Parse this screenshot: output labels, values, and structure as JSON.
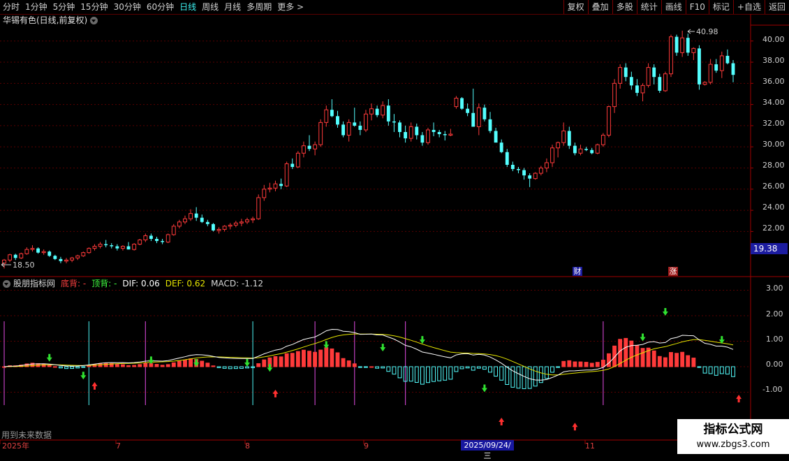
{
  "toolbar": {
    "periods": [
      "分时",
      "1分钟",
      "5分钟",
      "15分钟",
      "30分钟",
      "60分钟",
      "日线",
      "周线",
      "月线",
      "多周期",
      "更多 >"
    ],
    "active_period": "日线",
    "right_buttons": [
      "复权",
      "叠加",
      "多股",
      "统计",
      "画线",
      "F10",
      "标记",
      "+自选",
      "返回"
    ]
  },
  "main_chart": {
    "title": "华锡有色(日线,前复权)",
    "y_axis_labels": [
      "40.00",
      "38.00",
      "36.00",
      "34.00",
      "32.00",
      "30.00",
      "28.00",
      "26.00",
      "24.00",
      "22.00"
    ],
    "high_marker": "40.98",
    "low_marker": "18.50",
    "current_price": "19.38",
    "event_badges": [
      "财",
      "涨"
    ]
  },
  "indicator": {
    "name": "股朋指标网",
    "bottom_div_label": "底背: -",
    "top_div_label": "顶背: -",
    "dif_label": "DIF: 0.06",
    "dea_label": "DEF: 0.62",
    "macd_label": "MACD: -1.12",
    "y_axis_labels": [
      "3.00",
      "2.00",
      "1.00",
      "0.00",
      "-1.00"
    ]
  },
  "x_axis": {
    "labels": [
      "2025年",
      "7",
      "8",
      "9",
      "11"
    ],
    "cursor_date": "2025/09/24/三"
  },
  "footer_note": "用到未来数据",
  "watermark": {
    "line1": "指标公式网",
    "line2": "www.zbgs3.com"
  },
  "colors": {
    "up": "#ff3a3a",
    "down": "#54ffff",
    "dif": "#ffffff",
    "dea": "#e6e600",
    "grid": "#5a0000",
    "accent_blue": "#1c1ca0"
  },
  "chart_data": {
    "type": "candlestick",
    "ohlc": [
      [
        19.0,
        19.4,
        18.5,
        19.3
      ],
      [
        19.3,
        19.9,
        19.1,
        19.8
      ],
      [
        19.8,
        19.9,
        19.3,
        19.5
      ],
      [
        19.5,
        20.0,
        19.4,
        19.9
      ],
      [
        19.9,
        20.5,
        19.8,
        20.3
      ],
      [
        20.3,
        20.7,
        20.1,
        20.4
      ],
      [
        20.4,
        20.5,
        19.9,
        20.0
      ],
      [
        20.0,
        20.3,
        19.8,
        20.1
      ],
      [
        20.1,
        20.2,
        19.6,
        19.7
      ],
      [
        19.7,
        19.8,
        19.3,
        19.4
      ],
      [
        19.4,
        19.6,
        19.0,
        19.2
      ],
      [
        19.2,
        19.5,
        19.0,
        19.3
      ],
      [
        19.3,
        19.6,
        19.1,
        19.5
      ],
      [
        19.5,
        19.8,
        19.3,
        19.7
      ],
      [
        19.7,
        20.1,
        19.6,
        20.0
      ],
      [
        20.0,
        20.5,
        19.9,
        20.4
      ],
      [
        20.4,
        20.8,
        20.2,
        20.6
      ],
      [
        20.6,
        21.0,
        20.4,
        20.8
      ],
      [
        20.8,
        21.2,
        20.5,
        20.7
      ],
      [
        20.7,
        20.9,
        20.4,
        20.6
      ],
      [
        20.6,
        20.8,
        20.2,
        20.4
      ],
      [
        20.4,
        20.7,
        20.2,
        20.6
      ],
      [
        20.6,
        21.0,
        20.3,
        20.3
      ],
      [
        20.3,
        20.9,
        20.2,
        20.8
      ],
      [
        20.8,
        21.3,
        20.7,
        21.2
      ],
      [
        21.2,
        21.8,
        21.0,
        21.6
      ],
      [
        21.6,
        21.8,
        21.1,
        21.3
      ],
      [
        21.3,
        21.5,
        20.9,
        21.1
      ],
      [
        21.1,
        21.3,
        20.8,
        21.0
      ],
      [
        21.0,
        21.8,
        20.9,
        21.7
      ],
      [
        21.7,
        22.7,
        21.6,
        22.5
      ],
      [
        22.5,
        23.1,
        22.3,
        22.9
      ],
      [
        22.9,
        23.5,
        22.7,
        23.2
      ],
      [
        23.2,
        24.1,
        23.0,
        23.7
      ],
      [
        23.7,
        24.3,
        23.0,
        23.3
      ],
      [
        23.3,
        23.6,
        22.8,
        22.9
      ],
      [
        22.9,
        23.1,
        22.5,
        22.7
      ],
      [
        22.7,
        22.8,
        22.0,
        22.1
      ],
      [
        22.1,
        22.4,
        21.8,
        22.2
      ],
      [
        22.2,
        22.6,
        22.0,
        22.5
      ],
      [
        22.5,
        22.8,
        22.2,
        22.6
      ],
      [
        22.6,
        23.0,
        22.4,
        22.8
      ],
      [
        22.8,
        23.2,
        22.5,
        22.9
      ],
      [
        22.9,
        23.3,
        22.7,
        23.1
      ],
      [
        23.1,
        23.4,
        22.8,
        23.2
      ],
      [
        23.2,
        25.5,
        23.1,
        25.2
      ],
      [
        25.2,
        26.4,
        24.9,
        26.0
      ],
      [
        26.0,
        26.6,
        25.7,
        26.1
      ],
      [
        26.1,
        26.8,
        25.8,
        26.5
      ],
      [
        26.5,
        27.0,
        26.0,
        26.3
      ],
      [
        26.3,
        28.6,
        26.2,
        28.4
      ],
      [
        28.4,
        28.9,
        27.9,
        28.1
      ],
      [
        28.1,
        29.6,
        28.0,
        29.4
      ],
      [
        29.4,
        30.5,
        29.0,
        30.1
      ],
      [
        30.1,
        31.1,
        29.6,
        29.8
      ],
      [
        29.8,
        30.5,
        29.2,
        30.2
      ],
      [
        30.2,
        32.6,
        30.0,
        32.3
      ],
      [
        32.3,
        33.9,
        31.9,
        33.5
      ],
      [
        33.5,
        34.5,
        32.8,
        32.9
      ],
      [
        32.9,
        33.4,
        31.8,
        32.1
      ],
      [
        32.1,
        32.4,
        30.9,
        31.1
      ],
      [
        31.1,
        32.6,
        30.5,
        32.3
      ],
      [
        32.3,
        33.7,
        31.9,
        32.0
      ],
      [
        32.0,
        32.4,
        31.1,
        31.6
      ],
      [
        31.6,
        33.5,
        31.4,
        33.1
      ],
      [
        33.1,
        34.1,
        32.5,
        33.6
      ],
      [
        33.6,
        33.9,
        32.8,
        33.0
      ],
      [
        33.0,
        34.3,
        32.7,
        33.9
      ],
      [
        33.9,
        34.5,
        32.0,
        32.4
      ],
      [
        32.4,
        33.1,
        31.4,
        32.3
      ],
      [
        32.3,
        32.5,
        30.9,
        31.4
      ],
      [
        31.4,
        32.0,
        30.4,
        30.8
      ],
      [
        30.8,
        32.3,
        30.5,
        31.9
      ],
      [
        31.9,
        32.2,
        30.7,
        31.1
      ],
      [
        31.1,
        31.4,
        30.1,
        30.4
      ],
      [
        30.4,
        31.8,
        30.2,
        31.6
      ],
      [
        31.6,
        32.3,
        31.0,
        31.4
      ],
      [
        31.4,
        31.6,
        30.9,
        31.2
      ],
      [
        31.2,
        31.5,
        30.6,
        31.1
      ],
      [
        31.1,
        31.7,
        31.0,
        31.2
      ],
      [
        33.8,
        34.8,
        33.6,
        34.6
      ],
      [
        34.6,
        34.7,
        33.5,
        33.6
      ],
      [
        33.6,
        34.1,
        32.9,
        33.2
      ],
      [
        33.2,
        35.5,
        32.0,
        31.9
      ],
      [
        31.9,
        34.1,
        31.1,
        33.7
      ],
      [
        33.7,
        34.0,
        32.4,
        32.6
      ],
      [
        32.6,
        33.3,
        31.3,
        31.5
      ],
      [
        31.5,
        31.8,
        30.5,
        30.4
      ],
      [
        30.4,
        30.7,
        29.4,
        29.5
      ],
      [
        29.5,
        29.8,
        28.1,
        28.3
      ],
      [
        28.3,
        28.6,
        27.7,
        27.9
      ],
      [
        27.9,
        28.1,
        27.5,
        27.8
      ],
      [
        27.8,
        28.0,
        26.9,
        27.3
      ],
      [
        27.3,
        27.5,
        26.2,
        27.0
      ],
      [
        27.0,
        27.6,
        26.9,
        27.5
      ],
      [
        27.5,
        28.2,
        27.3,
        28.0
      ],
      [
        28.0,
        28.9,
        27.6,
        28.5
      ],
      [
        28.5,
        30.2,
        28.1,
        29.9
      ],
      [
        29.9,
        30.5,
        29.0,
        30.4
      ],
      [
        30.4,
        32.3,
        30.1,
        31.5
      ],
      [
        31.5,
        31.9,
        29.8,
        30.1
      ],
      [
        30.1,
        30.4,
        29.2,
        29.4
      ],
      [
        29.4,
        30.2,
        29.2,
        29.8
      ],
      [
        29.8,
        30.0,
        29.6,
        29.7
      ],
      [
        29.7,
        29.9,
        29.3,
        29.4
      ],
      [
        29.4,
        30.3,
        29.3,
        30.2
      ],
      [
        30.2,
        31.3,
        30.0,
        31.1
      ],
      [
        31.1,
        33.9,
        30.9,
        33.8
      ],
      [
        33.8,
        36.4,
        33.2,
        36.0
      ],
      [
        36.0,
        37.8,
        35.5,
        37.5
      ],
      [
        37.5,
        37.9,
        36.2,
        36.6
      ],
      [
        36.6,
        37.1,
        35.4,
        35.8
      ],
      [
        35.8,
        36.4,
        34.8,
        35.1
      ],
      [
        35.1,
        36.0,
        34.3,
        35.8
      ],
      [
        35.8,
        37.9,
        35.6,
        37.5
      ],
      [
        37.5,
        37.8,
        35.9,
        36.6
      ],
      [
        36.6,
        36.9,
        35.1,
        35.3
      ],
      [
        35.3,
        37.1,
        35.2,
        36.9
      ],
      [
        36.9,
        40.6,
        36.6,
        40.4
      ],
      [
        40.4,
        40.6,
        38.6,
        38.9
      ],
      [
        38.9,
        40.98,
        38.5,
        40.3
      ],
      [
        40.3,
        40.7,
        38.6,
        38.9
      ],
      [
        38.9,
        39.4,
        38.2,
        39.3
      ],
      [
        39.3,
        39.6,
        35.4,
        35.9
      ],
      [
        35.9,
        36.2,
        35.8,
        36.1
      ],
      [
        36.1,
        38.3,
        35.9,
        37.8
      ],
      [
        37.8,
        38.3,
        37.0,
        37.2
      ],
      [
        37.2,
        39.0,
        36.5,
        38.6
      ],
      [
        38.6,
        39.2,
        37.8,
        37.9
      ],
      [
        37.9,
        38.2,
        36.1,
        36.8
      ]
    ],
    "indicator_y_range": [
      -2.0,
      3.3
    ],
    "price_y_range": [
      18.0,
      41.5
    ]
  }
}
